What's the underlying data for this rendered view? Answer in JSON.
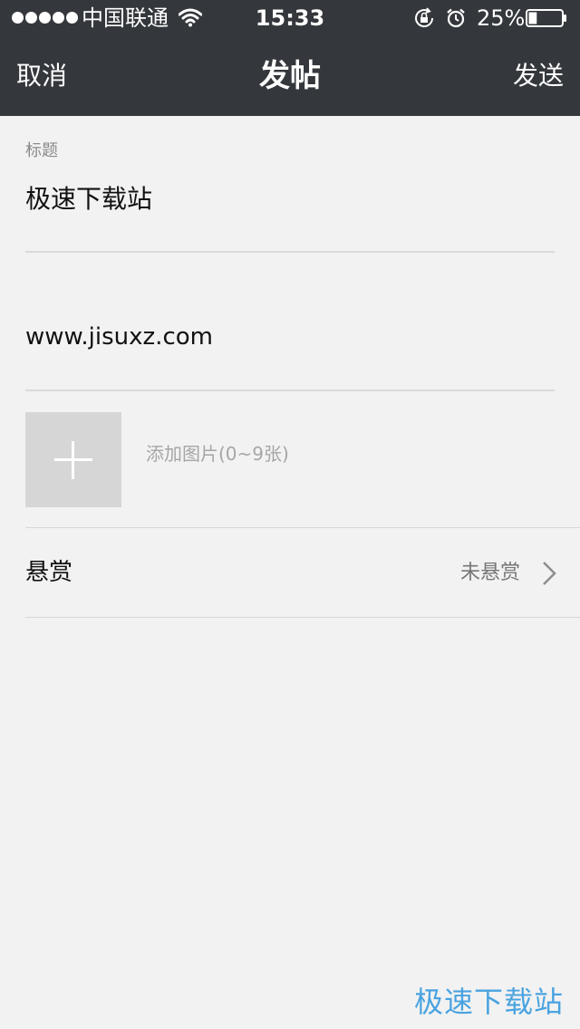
{
  "status_bar": {
    "carrier": "中国联通",
    "time": "15:33",
    "battery": "25%",
    "battery_level": 0.25,
    "icons": [
      "signal-dots-icon",
      "wifi-icon",
      "rotation-lock-icon",
      "alarm-icon",
      "battery-icon"
    ]
  },
  "nav": {
    "cancel_label": "取消",
    "title": "发帖",
    "send_label": "发送"
  },
  "form": {
    "title_label": "标题",
    "title_value": "极速下载站",
    "content_value": "www.jisuxz.com",
    "add_image_hint": "添加图片(0~9张)",
    "reward_label": "悬赏",
    "reward_value": "未悬赏"
  },
  "watermark": "极速下载站",
  "colors": {
    "header_bg": "#34383c",
    "page_bg": "#f2f2f2",
    "watermark": "#4aa3e0"
  }
}
